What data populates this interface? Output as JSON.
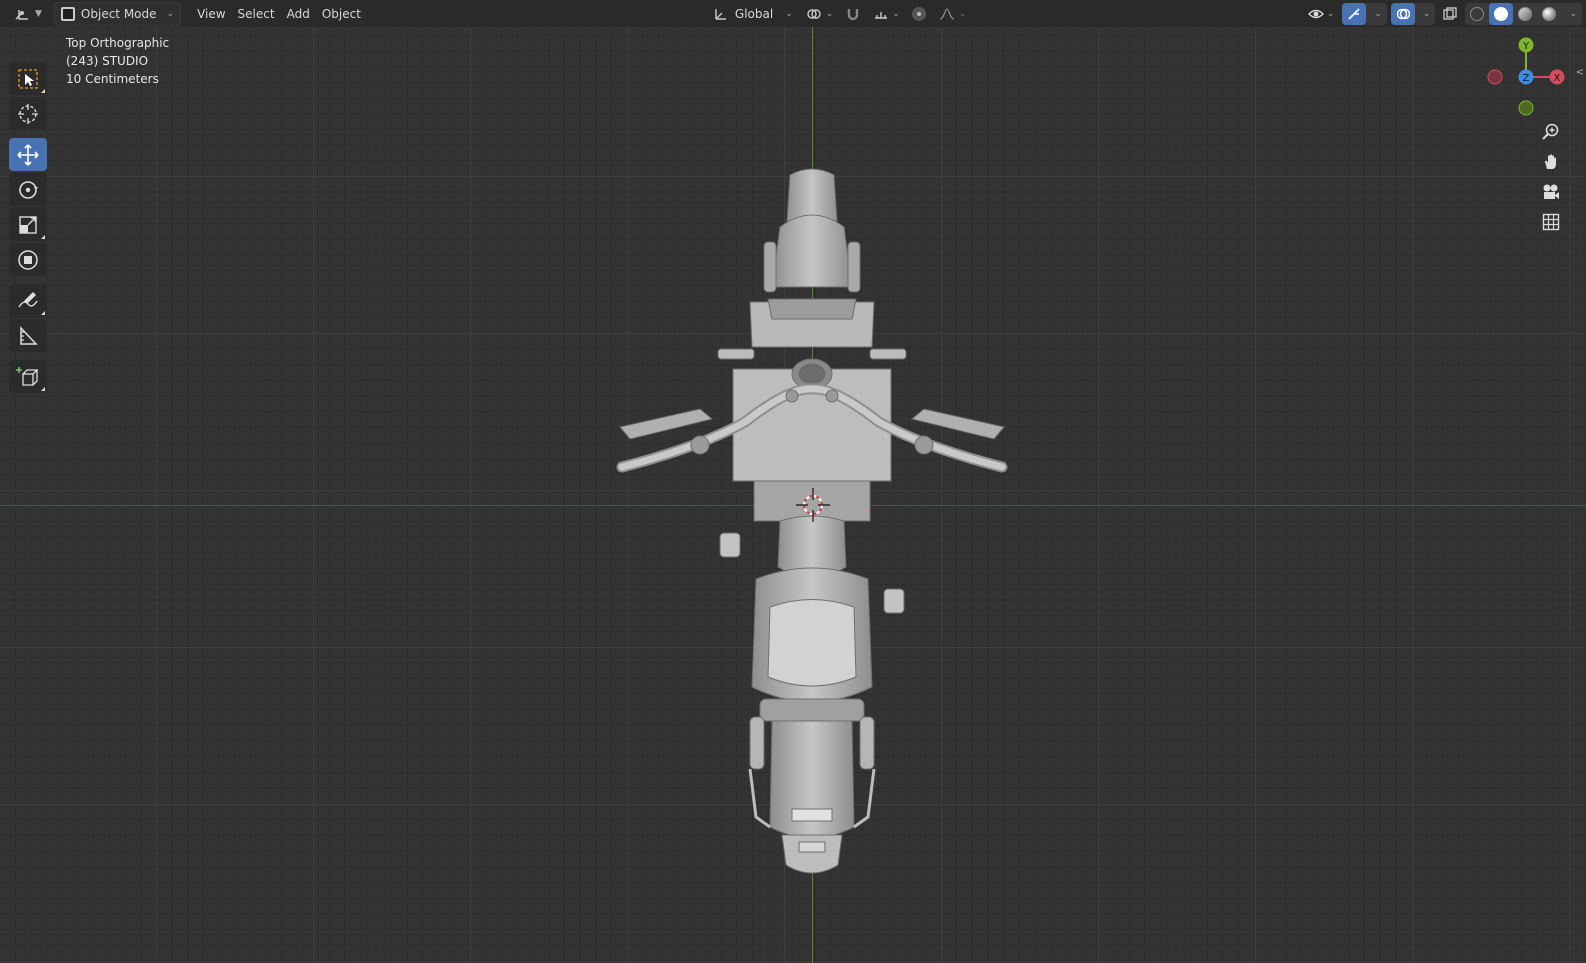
{
  "header": {
    "mode_label": "Object Mode",
    "menus": [
      "View",
      "Select",
      "Add",
      "Object"
    ],
    "transform_orientation": "Global"
  },
  "viewport": {
    "view_name": "Top Orthographic",
    "collection_info": "(243) STUDIO",
    "scale_info": "10 Centimeters"
  },
  "gizmo": {
    "x_label": "X",
    "y_label": "Y",
    "z_label": "Z",
    "x_color": "#d44c5e",
    "y_color": "#7fb42e",
    "z_color": "#3f8ce3"
  },
  "colors": {
    "accent": "#4772b3",
    "axis_x": "#8a3a44",
    "axis_y": "#5f7d2c"
  },
  "toolbar_tools": [
    "select-box",
    "cursor",
    "move",
    "rotate",
    "scale",
    "transform",
    "annotate",
    "measure",
    "add-cube"
  ],
  "active_tool": "move"
}
